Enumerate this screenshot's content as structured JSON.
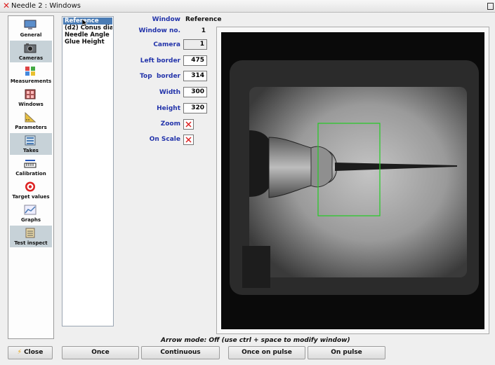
{
  "window": {
    "title": "Needle 2 : Windows"
  },
  "sidebar": {
    "items": [
      {
        "label": "General",
        "icon": "monitor-icon"
      },
      {
        "label": "Cameras",
        "icon": "camera-icon"
      },
      {
        "label": "Measurements",
        "icon": "grid-icon"
      },
      {
        "label": "Windows",
        "icon": "windows-icon"
      },
      {
        "label": "Parameters",
        "icon": "ruler-icon"
      },
      {
        "label": "Takes",
        "icon": "takes-icon"
      },
      {
        "label": "Calibration",
        "icon": "calibration-icon"
      },
      {
        "label": "Target values",
        "icon": "target-icon"
      },
      {
        "label": "Graphs",
        "icon": "graph-icon"
      },
      {
        "label": "Test inspect",
        "icon": "clipboard-icon"
      }
    ],
    "selected": "Cameras",
    "close_label": "Close"
  },
  "window_list": {
    "items": [
      "Reference",
      "(d2) Conus dia",
      "Needle Angle",
      "Glue Height"
    ],
    "selected": "Reference"
  },
  "form": {
    "window_label": "Window",
    "window_value": "Reference",
    "window_no_label": "Window no.",
    "window_no_value": "1",
    "camera_label": "Camera",
    "camera_value": "1",
    "left_border_label": "Left border",
    "left_border_value": "475",
    "top_border_label": "Top  border",
    "top_border_value": "314",
    "width_label": "Width",
    "width_value": "300",
    "height_label": "Height",
    "height_value": "320",
    "zoom_label": "Zoom",
    "zoom_checked": false,
    "on_scale_label": "On Scale",
    "on_scale_checked": false
  },
  "status": {
    "arrow_mode": "Arrow mode: Off (use ctrl + space to modify window)"
  },
  "buttons": {
    "once": "Once",
    "continuous": "Continuous",
    "once_on_pulse": "Once on pulse",
    "on_pulse": "On pulse"
  },
  "colors": {
    "roi": "#22cc22",
    "label": "#2233aa",
    "selection": "#4a7cb5"
  }
}
